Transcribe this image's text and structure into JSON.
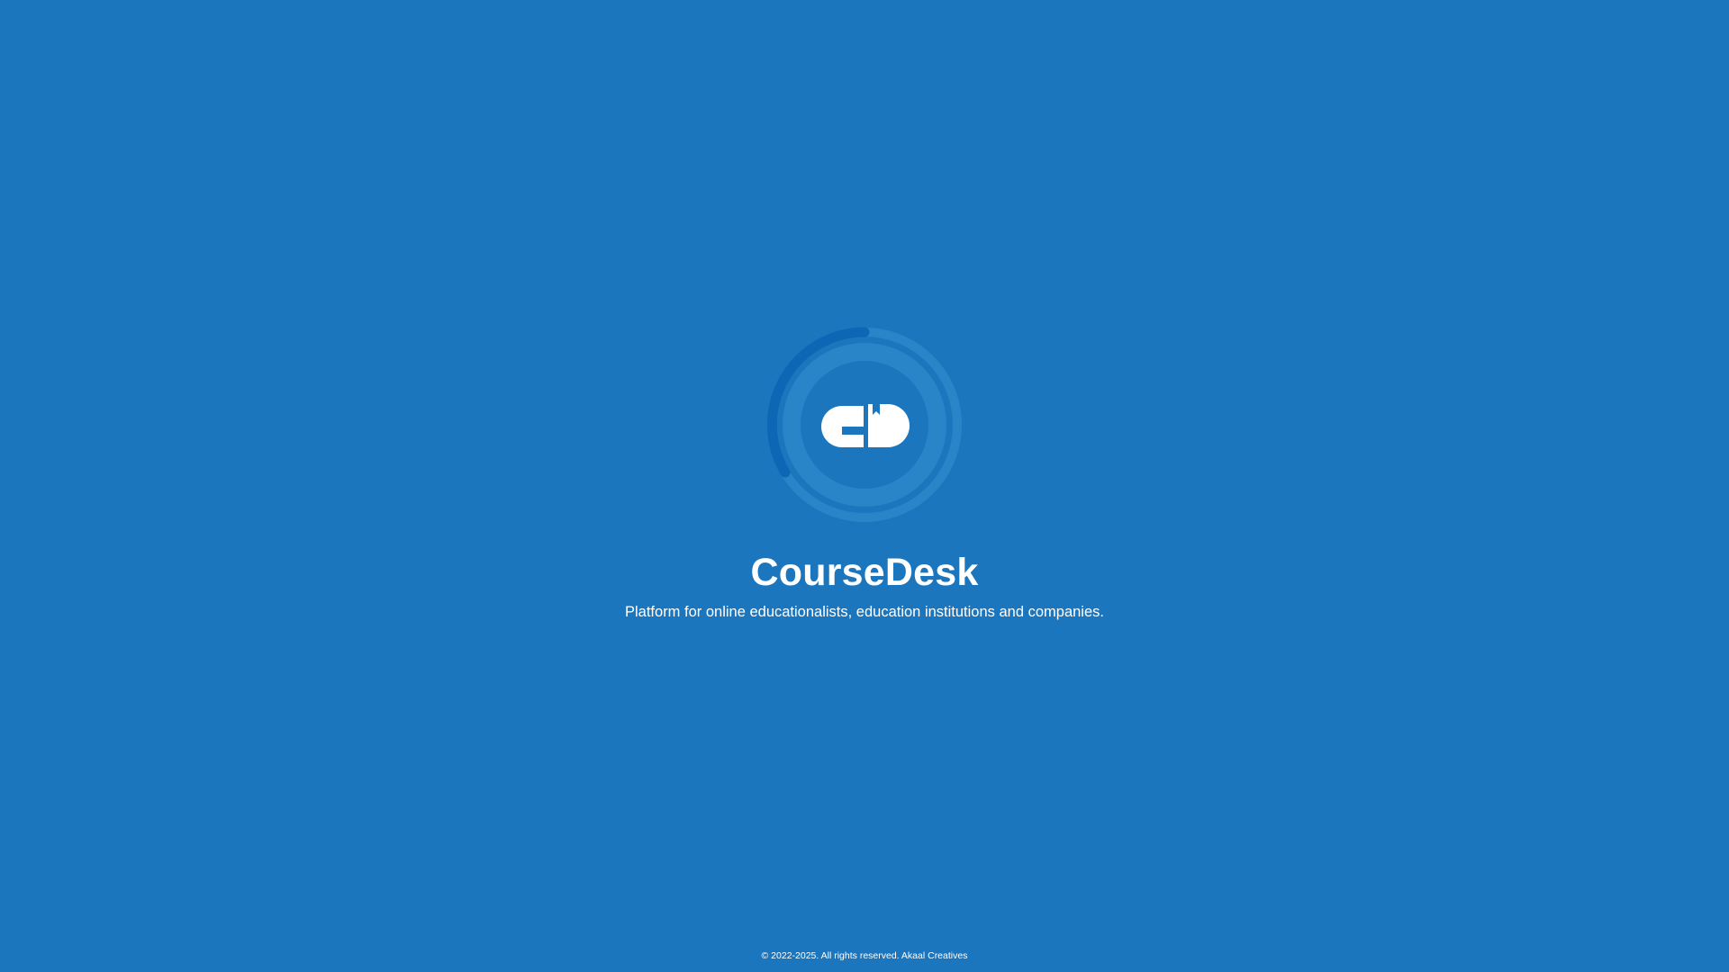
{
  "app": {
    "name": "CourseDesk",
    "tagline": "Platform for online educationalists, education institutions and companies.",
    "logo_icon": "coursedesk-logo-icon",
    "loading_icon": "loading-spinner-icon"
  },
  "footer": {
    "copyright": "© 2022-2025. All rights reserved. Akaal Creatives"
  },
  "colors": {
    "background": "#1b76bd",
    "ring": "#2a84c8",
    "spinner_arc": "#0e67b4",
    "logo": "#ffffff"
  }
}
